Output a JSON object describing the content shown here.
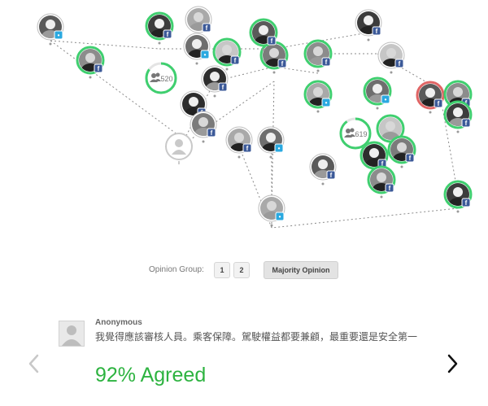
{
  "graph": {
    "colors": {
      "ring_green": "#3fcf6f",
      "ring_red": "#e06565",
      "ring_track": "#e4e4e4",
      "edge": "#8a8a8a",
      "facebook": "#3b5998",
      "twitter": "#2aa9e0"
    },
    "clusters": [
      {
        "label": "520",
        "icon": "group-icon",
        "agree_fraction": 0.85
      },
      {
        "label": "619",
        "icon": "group-icon",
        "agree_fraction": 0.9
      }
    ],
    "participants": [
      {
        "ring": "none",
        "badge": "twitter"
      },
      {
        "ring": "green",
        "badge": "facebook"
      },
      {
        "ring": "green",
        "badge": "facebook"
      },
      {
        "ring": "none",
        "badge": "facebook"
      },
      {
        "ring": "none",
        "badge": "twitter"
      },
      {
        "ring": "green",
        "badge": "facebook"
      },
      {
        "ring": "none",
        "badge": "facebook"
      },
      {
        "ring": "green",
        "badge": "facebook"
      },
      {
        "ring": "green",
        "badge": "facebook"
      },
      {
        "ring": "green",
        "badge": "facebook"
      },
      {
        "ring": "none",
        "badge": "facebook"
      },
      {
        "ring": "green",
        "badge": "twitter"
      },
      {
        "ring": "green",
        "badge": "twitter"
      },
      {
        "ring": "none",
        "badge": "facebook"
      },
      {
        "ring": "none",
        "badge": "facebook"
      },
      {
        "ring": "none",
        "badge": "facebook"
      },
      {
        "ring": "red",
        "badge": "facebook"
      },
      {
        "ring": "green",
        "badge": "facebook"
      },
      {
        "ring": "green",
        "badge": "facebook"
      },
      {
        "ring": "none",
        "badge": "facebook"
      },
      {
        "ring": "none",
        "badge": "twitter"
      },
      {
        "ring": "green",
        "badge": "none"
      },
      {
        "ring": "green",
        "badge": "facebook"
      },
      {
        "ring": "green",
        "badge": "facebook"
      },
      {
        "ring": "none",
        "badge": "facebook"
      },
      {
        "ring": "green",
        "badge": "facebook"
      },
      {
        "ring": "green",
        "badge": "facebook"
      },
      {
        "ring": "none",
        "badge": "twitter"
      },
      {
        "ring": "grey",
        "badge": "none"
      }
    ]
  },
  "opinion": {
    "label": "Opinion Group:",
    "groups": [
      "1",
      "2"
    ],
    "majority_label": "Majority Opinion"
  },
  "comment": {
    "author": "Anonymous",
    "text": "我覺得應該審核人員。乘客保障。駕駛權益都要兼顧，最重要還是安全第一",
    "agree_text": "92% Agreed",
    "agree_percent": 92,
    "agree_color": "#2db340"
  },
  "nav": {
    "prev_icon": "chevron-left-icon",
    "next_icon": "chevron-right-icon"
  }
}
